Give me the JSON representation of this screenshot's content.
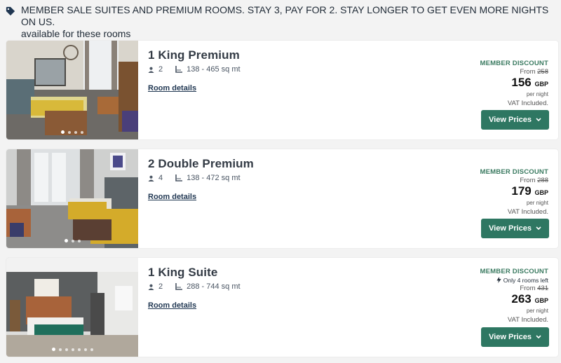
{
  "promo": {
    "headline": "MEMBER SALE SUITES AND PREMIUM ROOMS. STAY 3, PAY FOR 2. STAY LONGER TO GET EVEN MORE NIGHTS ON US.",
    "subline": "available for these rooms"
  },
  "rooms": [
    {
      "name": "1 King Premium",
      "guests": "2",
      "size": "138 - 465 sq mt",
      "details_label": "Room details",
      "member_label": "MEMBER DISCOUNT",
      "rooms_left": "",
      "from_label": "From",
      "old_price": "258",
      "price": "156",
      "currency": "GBP",
      "per_night": "per night",
      "vat": "VAT Included.",
      "button_label": "View Prices",
      "photo_dots": 4,
      "active_dot": 0
    },
    {
      "name": "2 Double Premium",
      "guests": "4",
      "size": "138 - 472 sq mt",
      "details_label": "Room details",
      "member_label": "MEMBER DISCOUNT",
      "rooms_left": "",
      "from_label": "From",
      "old_price": "288",
      "price": "179",
      "currency": "GBP",
      "per_night": "per night",
      "vat": "VAT Included.",
      "button_label": "View Prices",
      "photo_dots": 3,
      "active_dot": 0
    },
    {
      "name": "1 King Suite",
      "guests": "2",
      "size": "288 - 744 sq mt",
      "details_label": "Room details",
      "member_label": "MEMBER DISCOUNT",
      "rooms_left": "Only 4 rooms left",
      "from_label": "From",
      "old_price": "431",
      "price": "263",
      "currency": "GBP",
      "per_night": "per night",
      "vat": "VAT Included.",
      "button_label": "View Prices",
      "photo_dots": 7,
      "active_dot": 0
    }
  ],
  "colors": {
    "accent": "#2e7762",
    "member": "#3a7a60",
    "background": "#f3f3f3"
  }
}
